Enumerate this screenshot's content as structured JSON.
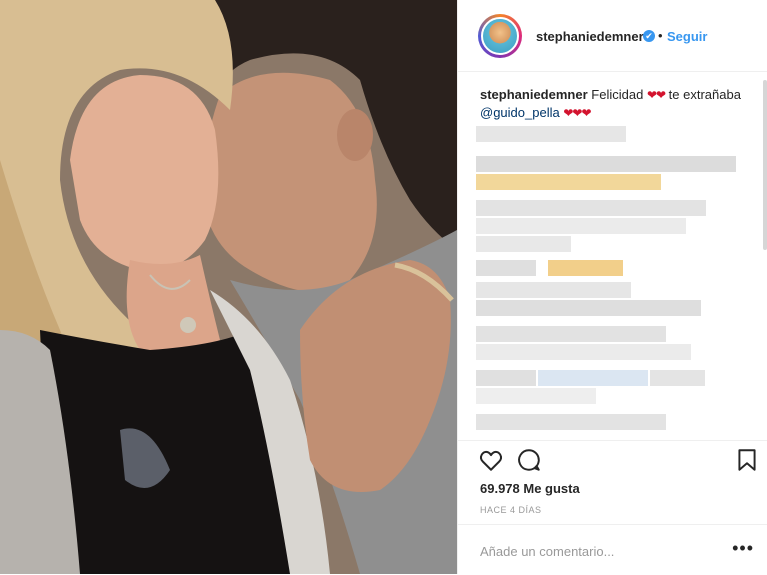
{
  "post": {
    "username": "stephaniedemner",
    "verified_mark": "✔",
    "separator": "•",
    "follow_label": "Seguir"
  },
  "caption": {
    "username": "stephaniedemner",
    "text_1": "Felicidad",
    "hearts_1": "❤❤",
    "text_2": "te extrañaba",
    "mention": "@guido_pella",
    "hearts_2": "❤❤❤"
  },
  "actions": {
    "like_icon": "heart-outline-icon",
    "comment_icon": "comment-bubble-icon",
    "save_icon": "bookmark-icon",
    "likes_label": "69.978 Me gusta",
    "time_label": "HACE 4 DÍAS"
  },
  "comment_input": {
    "placeholder": "Añade un comentario...",
    "more_label": "•••"
  },
  "colors": {
    "accent": "#3897f0",
    "heart": "#d3132e",
    "text": "#262626",
    "muted": "#999999"
  }
}
